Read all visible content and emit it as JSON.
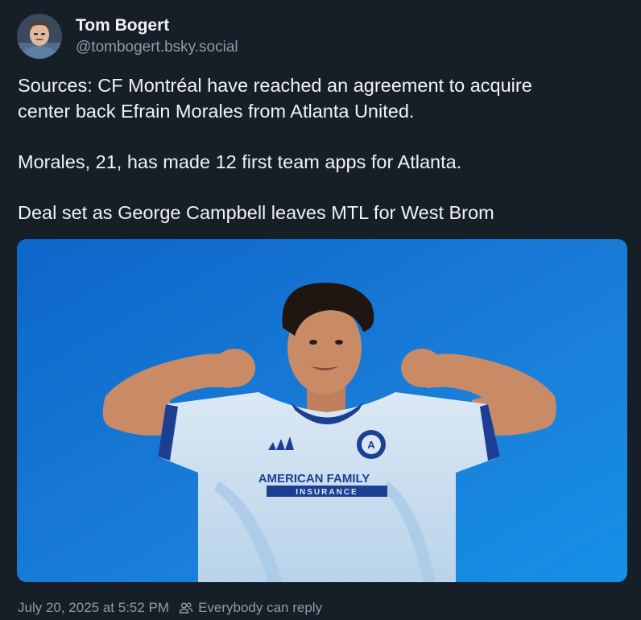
{
  "author": {
    "display_name": "Tom Bogert",
    "handle": "@tombogert.bsky.social",
    "avatar_icon": "avatar-photo"
  },
  "post": {
    "paragraphs": [
      "Sources: CF Montréal have reached an agreement to acquire",
      "center back Efrain Morales from Atlanta United.",
      "Morales, 21, has made 12 first team apps for Atlanta.",
      "Deal set as George Campbell leaves MTL for West Brom"
    ]
  },
  "media": {
    "jersey_sponsor_line1": "AMERICAN FAMILY",
    "jersey_sponsor_line2": "INSURANCE",
    "background_color": "#1a7fd9"
  },
  "footer": {
    "timestamp": "July 20, 2025 at 5:52 PM",
    "reply_setting": "Everybody can reply",
    "reply_icon": "people-icon"
  },
  "colors": {
    "background": "#161e27",
    "text_primary": "#f1f3f5",
    "text_secondary": "#8e9bab"
  }
}
